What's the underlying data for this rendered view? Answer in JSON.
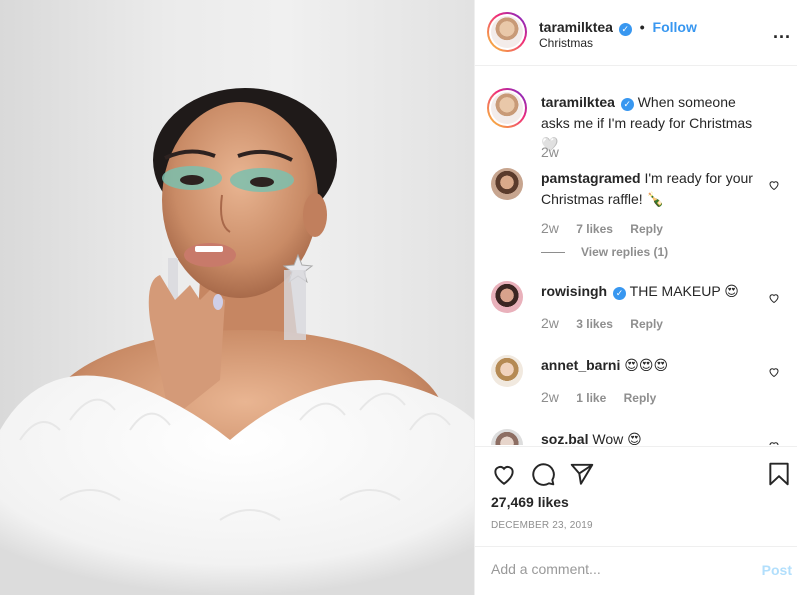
{
  "post": {
    "username": "taramilktea",
    "separator": "•",
    "follow_label": "Follow",
    "location": "Christmas",
    "more_label": "...",
    "verified_glyph": "✓"
  },
  "caption": {
    "username": "taramilktea",
    "text": "When someone asks me if I'm ready for Christmas 🤍",
    "time": "2w"
  },
  "comments": [
    {
      "username": "pamstagramed",
      "text": "I'm ready for your Christmas raffle! 🍾",
      "time": "2w",
      "likes": "7 likes",
      "reply": "Reply",
      "view_replies": "View replies (1)",
      "verified": false
    },
    {
      "username": "rowisingh",
      "text": "THE MAKEUP 😍",
      "time": "2w",
      "likes": "3 likes",
      "reply": "Reply",
      "verified": true
    },
    {
      "username": "annet_barni",
      "text": "😍😍😍",
      "time": "2w",
      "likes": "1 like",
      "reply": "Reply",
      "verified": false
    },
    {
      "username": "soz.bal",
      "text": "Wow 😍",
      "verified": false
    }
  ],
  "actions": {
    "icons": [
      "heart-icon",
      "comment-icon",
      "share-icon",
      "bookmark-icon"
    ],
    "likes": "27,469 likes",
    "date": "DECEMBER 23, 2019"
  },
  "composer": {
    "placeholder": "Add a comment...",
    "post_label": "Post"
  },
  "colors": {
    "link": "#3897f0",
    "post_disabled": "#b2dffc",
    "muted": "#8e8e8e"
  }
}
